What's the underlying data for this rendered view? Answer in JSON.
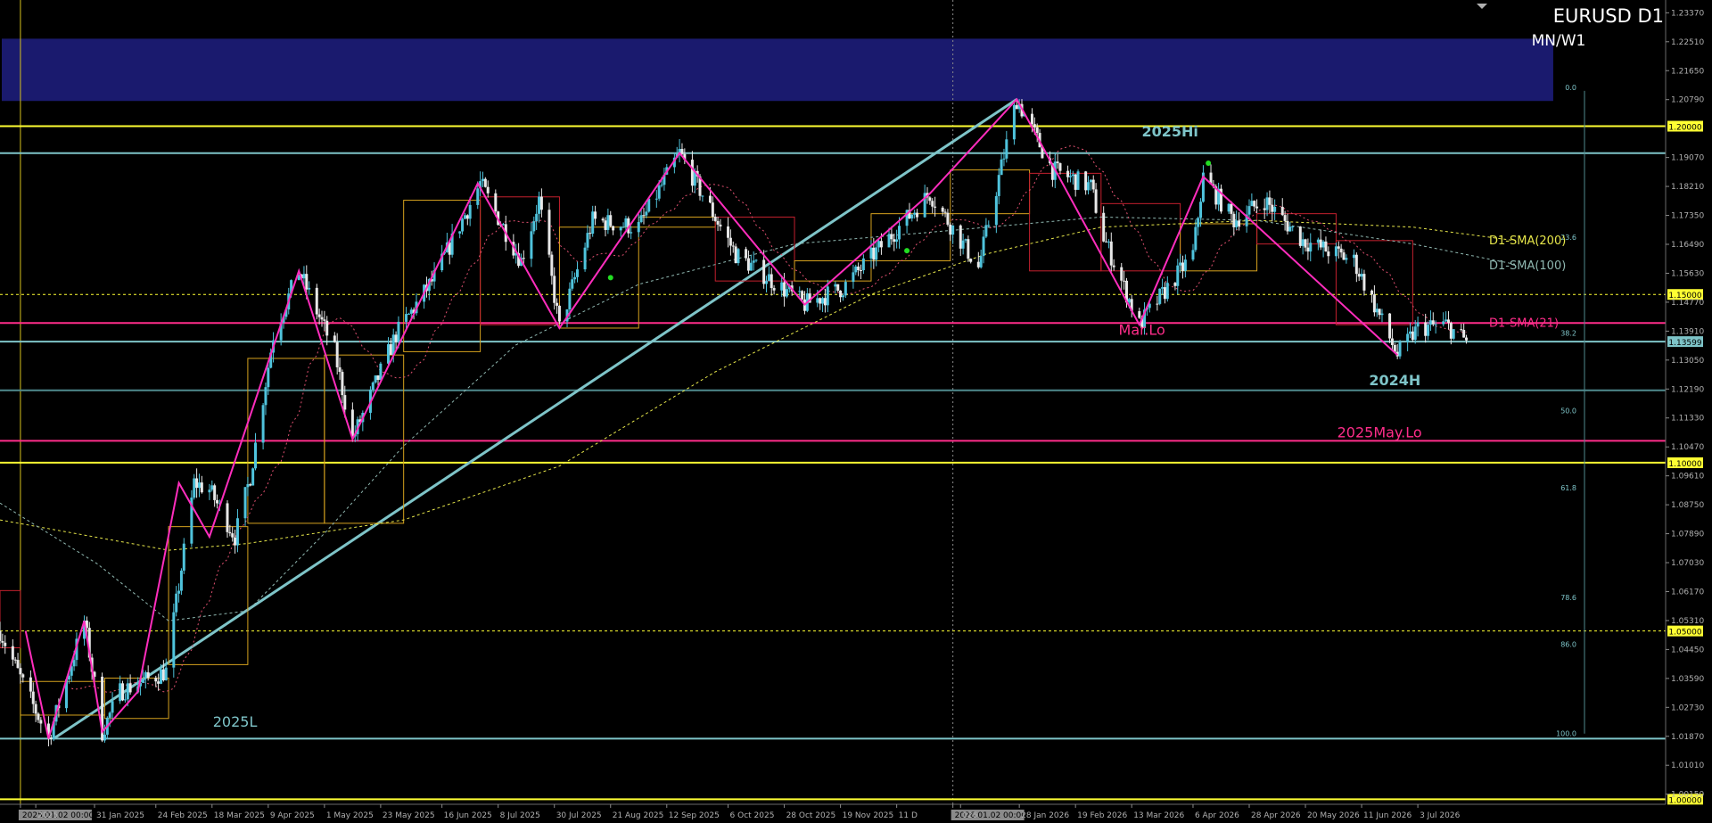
{
  "window": {
    "title": "EURUSD D1",
    "subtitle": "MN/W1"
  },
  "colors": {
    "background": "#000000",
    "bull_candle": "#4fc3dc",
    "bear_candle": "#e8e8e8",
    "level_yellow": "#ffff33",
    "level_teal": "#7ec4c8",
    "level_magenta": "#ff2d8a",
    "zigzag": "#ff2dbd",
    "box_orange": "#d6a21e",
    "box_red": "#c4202e",
    "band": "#1a1a6e",
    "sma200": "#e6e64a",
    "sma100": "#8fb7b0",
    "sma21": "#e05070"
  },
  "chart_data": {
    "type": "candlestick",
    "symbol": "EURUSD",
    "timeframe": "D1",
    "ylim": [
      0.9985,
      1.2375
    ],
    "xlim": [
      "2024-12-25",
      "2026-10-08"
    ],
    "price_ticks": [
      "1.23370",
      "1.22510",
      "1.21650",
      "1.20790",
      "1.19070",
      "1.18210",
      "1.17350",
      "1.16490",
      "1.15630",
      "1.14770",
      "1.13910",
      "1.13050",
      "1.12190",
      "1.11330",
      "1.10470",
      "1.09610",
      "1.08750",
      "1.07890",
      "1.07030",
      "1.06170",
      "1.05310",
      "1.04450",
      "1.03590",
      "1.02730",
      "1.01870",
      "1.01010",
      "1.00150"
    ],
    "date_labels": [
      {
        "date": "2025-01-02",
        "label": "2025.01.02 00:00",
        "highlight": true
      },
      {
        "date": "2025-01-08",
        "label": "2025"
      },
      {
        "date": "2025-01-31",
        "label": "31 Jan 2025"
      },
      {
        "date": "2025-02-24",
        "label": "24 Feb 2025"
      },
      {
        "date": "2025-03-18",
        "label": "18 Mar 2025"
      },
      {
        "date": "2025-04-09",
        "label": "9 Apr 2025"
      },
      {
        "date": "2025-05-01",
        "label": "1 May 2025"
      },
      {
        "date": "2025-05-23",
        "label": "23 May 2025"
      },
      {
        "date": "2025-06-16",
        "label": "16 Jun 2025"
      },
      {
        "date": "2025-07-08",
        "label": "8 Jul 2025"
      },
      {
        "date": "2025-07-30",
        "label": "30 Jul 2025"
      },
      {
        "date": "2025-08-21",
        "label": "21 Aug 2025"
      },
      {
        "date": "2025-09-12",
        "label": "12 Sep 2025"
      },
      {
        "date": "2025-10-06",
        "label": "6 Oct 2025"
      },
      {
        "date": "2025-10-28",
        "label": "28 Oct 2025"
      },
      {
        "date": "2025-11-19",
        "label": "19 Nov 2025"
      },
      {
        "date": "2025-12-11",
        "label": "11 D"
      },
      {
        "date": "2026-01-02",
        "label": "2026.01.02 00:00",
        "highlight": true
      },
      {
        "date": "2026-01-05",
        "label": "026"
      },
      {
        "date": "2026-01-28",
        "label": "28 Jan 2026"
      },
      {
        "date": "2026-02-19",
        "label": "19 Feb 2026"
      },
      {
        "date": "2026-03-13",
        "label": "13 Mar 2026"
      },
      {
        "date": "2026-04-06",
        "label": "6 Apr 2026"
      },
      {
        "date": "2026-04-28",
        "label": "28 Apr 2026"
      },
      {
        "date": "2026-05-20",
        "label": "20 May 2026"
      },
      {
        "date": "2026-06-11",
        "label": "11 Jun 2026"
      },
      {
        "date": "2026-07-03",
        "label": "3 Jul 2026"
      }
    ],
    "price_path": [
      [
        "2024-12-25",
        1.05
      ],
      [
        "2025-01-02",
        1.036
      ],
      [
        "2025-01-13",
        1.018
      ],
      [
        "2025-01-27",
        1.053
      ],
      [
        "2025-02-03",
        1.02
      ],
      [
        "2025-02-10",
        1.032
      ],
      [
        "2025-02-28",
        1.038
      ],
      [
        "2025-03-11",
        1.094
      ],
      [
        "2025-03-17",
        1.092
      ],
      [
        "2025-03-27",
        1.078
      ],
      [
        "2025-04-02",
        1.096
      ],
      [
        "2025-04-11",
        1.138
      ],
      [
        "2025-04-21",
        1.157
      ],
      [
        "2025-05-05",
        1.133
      ],
      [
        "2025-05-12",
        1.107
      ],
      [
        "2025-05-29",
        1.138
      ],
      [
        "2025-06-13",
        1.155
      ],
      [
        "2025-07-01",
        1.183
      ],
      [
        "2025-07-17",
        1.16
      ],
      [
        "2025-07-24",
        1.178
      ],
      [
        "2025-08-01",
        1.14
      ],
      [
        "2025-08-14",
        1.172
      ],
      [
        "2025-09-01",
        1.17
      ],
      [
        "2025-09-17",
        1.192
      ],
      [
        "2025-10-09",
        1.162
      ],
      [
        "2025-11-05",
        1.147
      ],
      [
        "2025-11-20",
        1.152
      ],
      [
        "2025-12-24",
        1.18
      ],
      [
        "2026-01-12",
        1.158
      ],
      [
        "2026-01-27",
        1.208
      ],
      [
        "2026-02-10",
        1.187
      ],
      [
        "2026-02-25",
        1.182
      ],
      [
        "2026-03-02",
        1.167
      ],
      [
        "2026-03-16",
        1.141
      ],
      [
        "2026-04-06",
        1.162
      ],
      [
        "2026-04-10",
        1.185
      ],
      [
        "2026-04-22",
        1.172
      ],
      [
        "2026-05-04",
        1.178
      ],
      [
        "2026-05-19",
        1.166
      ],
      [
        "2026-06-08",
        1.16
      ],
      [
        "2026-06-25",
        1.132
      ],
      [
        "2026-07-03",
        1.14
      ],
      [
        "2026-07-14",
        1.141
      ],
      [
        "2026-07-22",
        1.136
      ]
    ],
    "zigzag": [
      [
        "2025-01-04",
        1.05
      ],
      [
        "2025-01-13",
        1.018
      ],
      [
        "2025-01-27",
        1.053
      ],
      [
        "2025-02-03",
        1.02
      ],
      [
        "2025-02-17",
        1.032
      ],
      [
        "2025-03-05",
        1.094
      ],
      [
        "2025-03-17",
        1.078
      ],
      [
        "2025-04-21",
        1.157
      ],
      [
        "2025-05-12",
        1.107
      ],
      [
        "2025-06-30",
        1.183
      ],
      [
        "2025-08-01",
        1.14
      ],
      [
        "2025-09-17",
        1.192
      ],
      [
        "2025-11-05",
        1.147
      ],
      [
        "2025-12-24",
        1.18
      ],
      [
        "2026-01-27",
        1.208
      ],
      [
        "2026-03-16",
        1.141
      ],
      [
        "2026-04-10",
        1.185
      ],
      [
        "2026-06-25",
        1.132
      ]
    ],
    "trendline": [
      [
        "2025-01-15",
        1.018
      ],
      [
        "2026-01-27",
        1.208
      ]
    ],
    "horizontal_levels": [
      {
        "price": 1.2,
        "label": "1.20000",
        "style": "solid",
        "color": "#ffff33",
        "tag": true
      },
      {
        "price": 1.192,
        "label": "",
        "style": "solid",
        "color": "#7ec4c8",
        "tag": false
      },
      {
        "price": 1.15,
        "label": "1.15000",
        "style": "dashed",
        "color": "#ffff33",
        "tag": true
      },
      {
        "price": 1.1415,
        "label": "",
        "style": "solid",
        "color": "#ff2d8a",
        "tag": false
      },
      {
        "price": 1.13599,
        "label": "1.13599",
        "style": "solid",
        "color": "#7ec4c8",
        "tag": true
      },
      {
        "price": 1.1215,
        "label": "",
        "style": "solid",
        "color": "#4f8a8e",
        "tag": false
      },
      {
        "price": 1.1065,
        "label": "",
        "style": "solid",
        "color": "#ff2d8a",
        "tag": false
      },
      {
        "price": 1.1,
        "label": "1.10000",
        "style": "solid",
        "color": "#ffff33",
        "tag": true
      },
      {
        "price": 1.05,
        "label": "1.05000",
        "style": "dashed",
        "color": "#ffff33",
        "tag": true
      },
      {
        "price": 1.018,
        "label": "",
        "style": "solid",
        "color": "#7ec4c8",
        "tag": false
      },
      {
        "price": 1.0,
        "label": "1.00000",
        "style": "solid",
        "color": "#ffff33",
        "tag": true
      }
    ],
    "level_labels": [
      {
        "text": "2025Hi",
        "date": "2026-03-28",
        "price": 1.197,
        "color": "#7ec4c8",
        "bold": true
      },
      {
        "text": "2024H",
        "date": "2026-06-24",
        "price": 1.123,
        "color": "#7ec4c8",
        "bold": true
      },
      {
        "text": "Mar.Lo",
        "date": "2026-03-17",
        "price": 1.138,
        "color": "#ff2d8a",
        "bold": false
      },
      {
        "text": "2025May.Lo",
        "date": "2026-06-18",
        "price": 1.1075,
        "color": "#ff2d8a",
        "bold": false
      },
      {
        "text": "2025L",
        "date": "2025-03-27",
        "price": 1.0215,
        "color": "#7ec4c8",
        "bold": false
      }
    ],
    "fib_levels": [
      {
        "label": "0.0",
        "price": 1.2115
      },
      {
        "label": "23.6",
        "price": 1.167
      },
      {
        "label": "38.2",
        "price": 1.1385
      },
      {
        "label": "50.0",
        "price": 1.1155
      },
      {
        "label": "61.8",
        "price": 1.0925
      },
      {
        "label": "78.6",
        "price": 1.06
      },
      {
        "label": "86.0",
        "price": 1.046
      },
      {
        "label": "100.0",
        "price": 1.0195
      }
    ],
    "sma_labels": [
      {
        "text": "D1-SMA(200)",
        "price": 1.166,
        "color": "#e6e64a"
      },
      {
        "text": "D1-SMA(100)",
        "price": 1.1585,
        "color": "#8fb7b0"
      },
      {
        "text": "D1-SMA(21)",
        "price": 1.1415,
        "color": "#ff2d8a"
      }
    ],
    "sma200": [
      [
        "2024-12-25",
        1.083
      ],
      [
        "2025-03-01",
        1.074
      ],
      [
        "2025-04-01",
        1.076
      ],
      [
        "2025-06-01",
        1.083
      ],
      [
        "2025-08-01",
        1.099
      ],
      [
        "2025-10-01",
        1.127
      ],
      [
        "2025-12-01",
        1.15
      ],
      [
        "2026-01-15",
        1.162
      ],
      [
        "2026-03-01",
        1.17
      ],
      [
        "2026-05-01",
        1.172
      ],
      [
        "2026-07-01",
        1.17
      ],
      [
        "2026-08-10",
        1.166
      ]
    ],
    "sma100": [
      [
        "2024-12-25",
        1.088
      ],
      [
        "2025-02-01",
        1.07
      ],
      [
        "2025-03-01",
        1.053
      ],
      [
        "2025-04-01",
        1.056
      ],
      [
        "2025-05-01",
        1.079
      ],
      [
        "2025-06-01",
        1.105
      ],
      [
        "2025-07-15",
        1.135
      ],
      [
        "2025-09-01",
        1.153
      ],
      [
        "2025-11-01",
        1.165
      ],
      [
        "2026-01-01",
        1.169
      ],
      [
        "2026-03-01",
        1.173
      ],
      [
        "2026-05-01",
        1.172
      ],
      [
        "2026-07-01",
        1.165
      ],
      [
        "2026-08-10",
        1.159
      ]
    ],
    "weekly_boxes": [
      {
        "start": "2024-12-25",
        "end": "2025-01-02",
        "open": 1.045,
        "close": 1.062,
        "color": "red"
      },
      {
        "start": "2025-01-02",
        "end": "2025-02-04",
        "open": 1.025,
        "close": 1.035,
        "color": "orange"
      },
      {
        "start": "2025-02-04",
        "end": "2025-03-01",
        "open": 1.024,
        "close": 1.036,
        "color": "orange"
      },
      {
        "start": "2025-03-01",
        "end": "2025-04-01",
        "open": 1.04,
        "close": 1.081,
        "color": "orange"
      },
      {
        "start": "2025-04-01",
        "end": "2025-05-01",
        "open": 1.082,
        "close": 1.131,
        "color": "orange"
      },
      {
        "start": "2025-05-01",
        "end": "2025-06-01",
        "open": 1.132,
        "close": 1.082,
        "color": "orange"
      },
      {
        "start": "2025-06-01",
        "end": "2025-07-01",
        "open": 1.133,
        "close": 1.178,
        "color": "orange"
      },
      {
        "start": "2025-07-01",
        "end": "2025-08-01",
        "open": 1.179,
        "close": 1.141,
        "color": "red"
      },
      {
        "start": "2025-08-01",
        "end": "2025-09-01",
        "open": 1.14,
        "close": 1.17,
        "color": "orange"
      },
      {
        "start": "2025-09-01",
        "end": "2025-10-01",
        "open": 1.17,
        "close": 1.173,
        "color": "orange"
      },
      {
        "start": "2025-10-01",
        "end": "2025-11-01",
        "open": 1.173,
        "close": 1.154,
        "color": "red"
      },
      {
        "start": "2025-11-01",
        "end": "2025-12-01",
        "open": 1.154,
        "close": 1.16,
        "color": "orange"
      },
      {
        "start": "2025-12-01",
        "end": "2026-01-01",
        "open": 1.16,
        "close": 1.174,
        "color": "orange"
      },
      {
        "start": "2026-01-01",
        "end": "2026-02-01",
        "open": 1.174,
        "close": 1.187,
        "color": "orange"
      },
      {
        "start": "2026-02-01",
        "end": "2026-03-01",
        "open": 1.186,
        "close": 1.157,
        "color": "red"
      },
      {
        "start": "2026-03-01",
        "end": "2026-04-01",
        "open": 1.157,
        "close": 1.177,
        "color": "red"
      },
      {
        "start": "2026-04-01",
        "end": "2026-05-01",
        "open": 1.157,
        "close": 1.171,
        "color": "orange"
      },
      {
        "start": "2026-05-01",
        "end": "2026-06-01",
        "open": 1.174,
        "close": 1.165,
        "color": "red"
      },
      {
        "start": "2026-06-01",
        "end": "2026-07-01",
        "open": 1.166,
        "close": 1.141,
        "color": "red"
      }
    ],
    "signal_dots": [
      {
        "date": "2025-08-21",
        "price": 1.155
      },
      {
        "date": "2025-12-15",
        "price": 1.163
      },
      {
        "date": "2026-04-12",
        "price": 1.189
      }
    ],
    "band": {
      "top": 1.226,
      "bottom": 1.2075,
      "end": "2026-08-25"
    },
    "crosshair": {
      "date": "2026-01-02"
    }
  }
}
